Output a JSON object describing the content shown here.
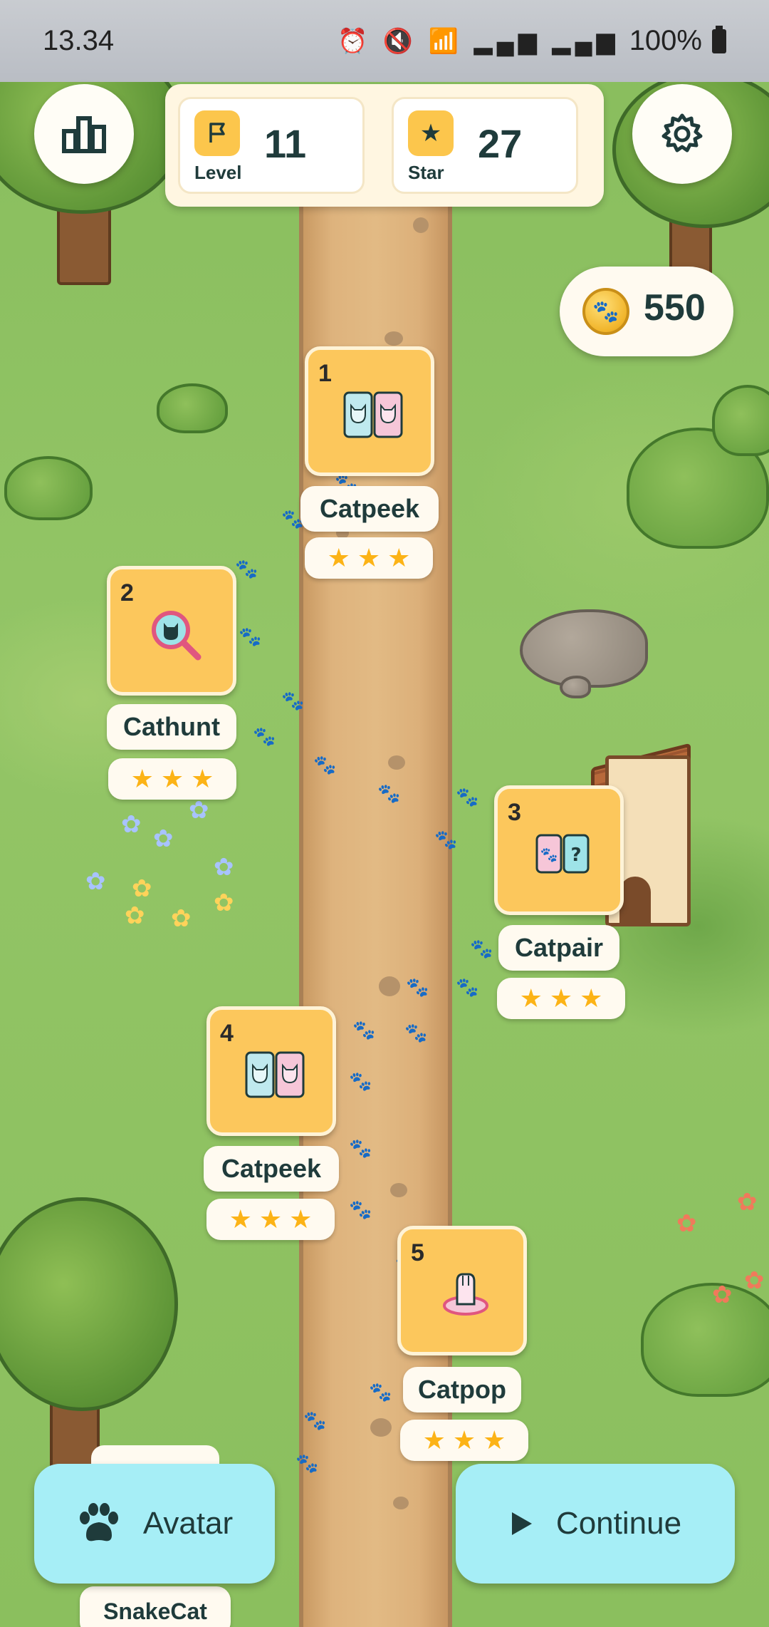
{
  "status_bar": {
    "time": "13.34",
    "icons": "⏰ 🔇 📶 ▂▄▆ ▂▄▆",
    "battery": "100%"
  },
  "hud": {
    "level_label": "Level",
    "level_value": "11",
    "star_label": "Star",
    "star_value": "27",
    "coins": "550"
  },
  "levels": [
    {
      "number": "1",
      "name": "Catpeek",
      "stars": 3
    },
    {
      "number": "2",
      "name": "Cathunt",
      "stars": 3
    },
    {
      "number": "3",
      "name": "Catpair",
      "stars": 3
    },
    {
      "number": "4",
      "name": "Catpeek",
      "stars": 3
    },
    {
      "number": "5",
      "name": "Catpop",
      "stars": 3
    }
  ],
  "partial_level": {
    "name": "SnakeCat"
  },
  "buttons": {
    "avatar": "Avatar",
    "continue": "Continue"
  },
  "colors": {
    "node_fill": "#fcc75c",
    "button_fill": "#a6eef6",
    "text_dark": "#1f3b3b",
    "star": "#fcb316"
  }
}
